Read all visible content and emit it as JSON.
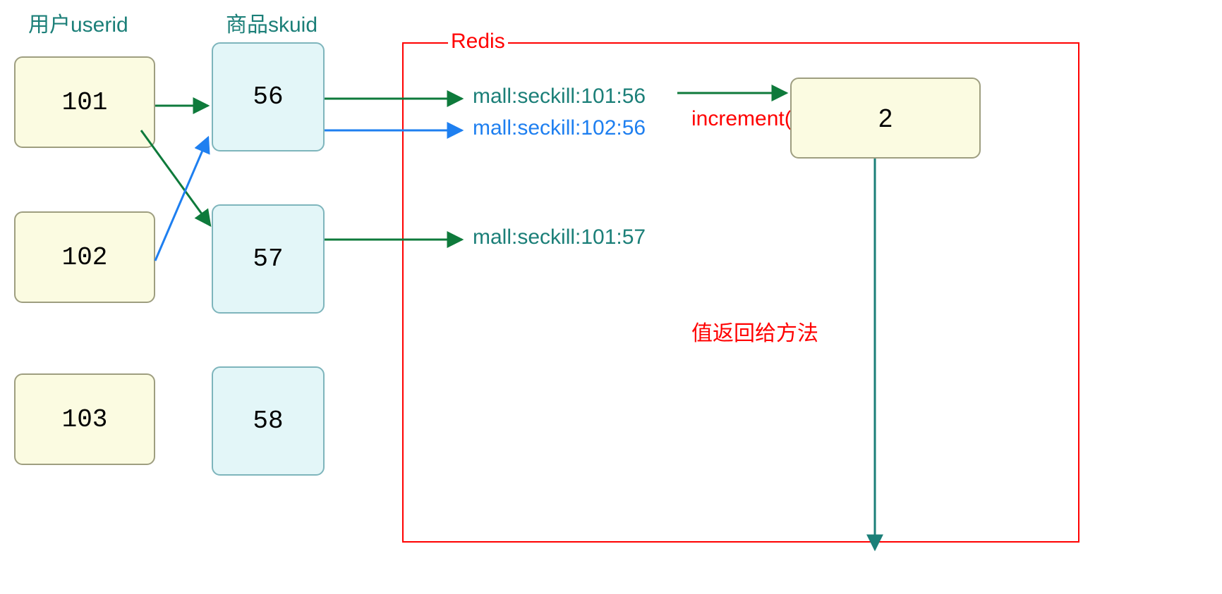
{
  "headers": {
    "user": "用户userid",
    "sku": "商品skuid"
  },
  "users": {
    "u1": "101",
    "u2": "102",
    "u3": "103"
  },
  "skus": {
    "s1": "56",
    "s2": "57",
    "s3": "58"
  },
  "redis": {
    "title": "Redis",
    "keys": {
      "k1": "mall:seckill:101:56",
      "k2": "mall:seckill:102:56",
      "k3": "mall:seckill:101:57"
    },
    "operation": "increment()",
    "returnLabel": "值返回给方法",
    "value": "2"
  },
  "colors": {
    "teal": "#1b7f78",
    "red": "#ff0000",
    "blue": "#1e7ff0",
    "green_arrow": "#0e7a3b",
    "blue_arrow": "#1e7ff0",
    "teal_arrow": "#1b7f78"
  }
}
